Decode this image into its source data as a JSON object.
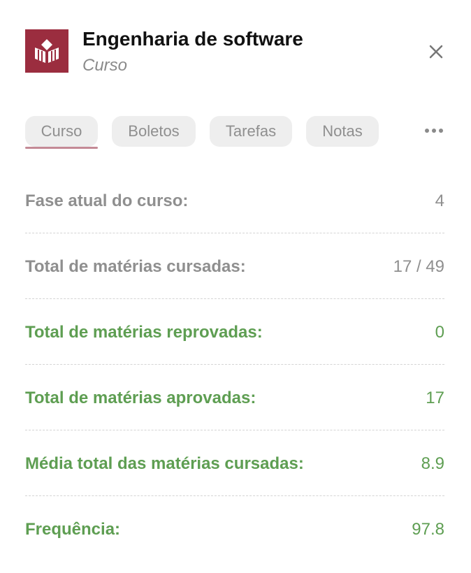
{
  "header": {
    "title": "Engenharia de software",
    "subtitle": "Curso",
    "logo_icon": "book-open-icon",
    "logo_color": "#9b2d3f",
    "close_icon": "close-icon"
  },
  "tabs": [
    {
      "label": "Curso",
      "active": true
    },
    {
      "label": "Boletos",
      "active": false
    },
    {
      "label": "Tarefas",
      "active": false
    },
    {
      "label": "Notas",
      "active": false
    }
  ],
  "more_icon": "more-horizontal-icon",
  "rows": [
    {
      "label": "Fase atual do curso:",
      "value": "4",
      "tone": "grey"
    },
    {
      "label": "Total de matérias cursadas:",
      "value": "17 / 49",
      "tone": "grey"
    },
    {
      "label": "Total de matérias reprovadas:",
      "value": "0",
      "tone": "green"
    },
    {
      "label": "Total de matérias aprovadas:",
      "value": "17",
      "tone": "green"
    },
    {
      "label": "Média total das matérias cursadas:",
      "value": "8.9",
      "tone": "green"
    },
    {
      "label": "Frequência:",
      "value": "97.8",
      "tone": "green"
    }
  ],
  "colors": {
    "grey_text": "#8f8f8f",
    "green_text": "#5e9e52",
    "active_tab_underline": "#c48a96"
  }
}
